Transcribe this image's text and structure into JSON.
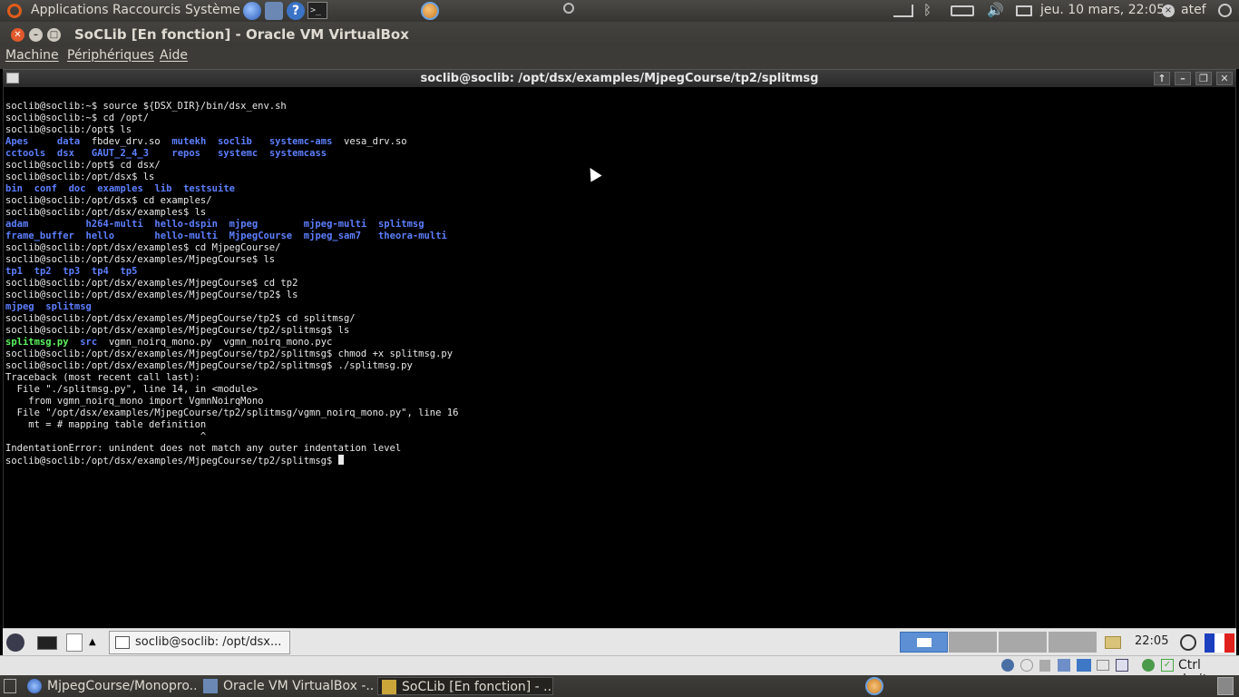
{
  "host_top_panel": {
    "menus": [
      "Applications",
      "Raccourcis",
      "Système"
    ],
    "datetime": "jeu. 10 mars, 22:05",
    "user": "atef"
  },
  "vbox_window": {
    "title": "SoCLib [En fonction] - Oracle VM VirtualBox",
    "menu": [
      "Machine",
      "Périphériques",
      "Aide"
    ]
  },
  "guest": {
    "terminal_title": "soclib@soclib: /opt/dsx/examples/MjpegCourse/tp2/splitmsg",
    "terminal_lines": [
      [
        {
          "t": "soclib@soclib:~$ source ${DSX_DIR}/bin/dsx_env.sh"
        }
      ],
      [
        {
          "t": "soclib@soclib:~$ cd /opt/"
        }
      ],
      [
        {
          "t": "soclib@soclib:/opt$ ls"
        }
      ],
      [
        {
          "t": "Apes",
          "c": "dir"
        },
        {
          "t": "     "
        },
        {
          "t": "data",
          "c": "dir"
        },
        {
          "t": "  fbdev_drv.so  "
        },
        {
          "t": "mutekh",
          "c": "dir"
        },
        {
          "t": "  "
        },
        {
          "t": "soclib",
          "c": "dir"
        },
        {
          "t": "   "
        },
        {
          "t": "systemc-ams",
          "c": "dir"
        },
        {
          "t": "  vesa_drv.so"
        }
      ],
      [
        {
          "t": "cctools",
          "c": "dir"
        },
        {
          "t": "  "
        },
        {
          "t": "dsx",
          "c": "dir"
        },
        {
          "t": "   "
        },
        {
          "t": "GAUT_2_4_3",
          "c": "dir"
        },
        {
          "t": "    "
        },
        {
          "t": "repos",
          "c": "dir"
        },
        {
          "t": "   "
        },
        {
          "t": "systemc",
          "c": "dir"
        },
        {
          "t": "  "
        },
        {
          "t": "systemcass",
          "c": "dir"
        }
      ],
      [
        {
          "t": "soclib@soclib:/opt$ cd dsx/"
        }
      ],
      [
        {
          "t": "soclib@soclib:/opt/dsx$ ls"
        }
      ],
      [
        {
          "t": "bin",
          "c": "dir"
        },
        {
          "t": "  "
        },
        {
          "t": "conf",
          "c": "dir"
        },
        {
          "t": "  "
        },
        {
          "t": "doc",
          "c": "dir"
        },
        {
          "t": "  "
        },
        {
          "t": "examples",
          "c": "dir"
        },
        {
          "t": "  "
        },
        {
          "t": "lib",
          "c": "dir"
        },
        {
          "t": "  "
        },
        {
          "t": "testsuite",
          "c": "dir"
        }
      ],
      [
        {
          "t": "soclib@soclib:/opt/dsx$ cd examples/"
        }
      ],
      [
        {
          "t": "soclib@soclib:/opt/dsx/examples$ ls"
        }
      ],
      [
        {
          "t": "adam",
          "c": "dir"
        },
        {
          "t": "          "
        },
        {
          "t": "h264-multi",
          "c": "dir"
        },
        {
          "t": "  "
        },
        {
          "t": "hello-dspin",
          "c": "dir"
        },
        {
          "t": "  "
        },
        {
          "t": "mjpeg",
          "c": "dir"
        },
        {
          "t": "        "
        },
        {
          "t": "mjpeg-multi",
          "c": "dir"
        },
        {
          "t": "  "
        },
        {
          "t": "splitmsg",
          "c": "dir"
        }
      ],
      [
        {
          "t": "frame_buffer",
          "c": "dir"
        },
        {
          "t": "  "
        },
        {
          "t": "hello",
          "c": "dir"
        },
        {
          "t": "       "
        },
        {
          "t": "hello-multi",
          "c": "dir"
        },
        {
          "t": "  "
        },
        {
          "t": "MjpegCourse",
          "c": "dir"
        },
        {
          "t": "  "
        },
        {
          "t": "mjpeg_sam7",
          "c": "dir"
        },
        {
          "t": "   "
        },
        {
          "t": "theora-multi",
          "c": "dir"
        }
      ],
      [
        {
          "t": "soclib@soclib:/opt/dsx/examples$ cd MjpegCourse/"
        }
      ],
      [
        {
          "t": "soclib@soclib:/opt/dsx/examples/MjpegCourse$ ls"
        }
      ],
      [
        {
          "t": "tp1",
          "c": "dir"
        },
        {
          "t": "  "
        },
        {
          "t": "tp2",
          "c": "dir"
        },
        {
          "t": "  "
        },
        {
          "t": "tp3",
          "c": "dir"
        },
        {
          "t": "  "
        },
        {
          "t": "tp4",
          "c": "dir"
        },
        {
          "t": "  "
        },
        {
          "t": "tp5",
          "c": "dir"
        }
      ],
      [
        {
          "t": "soclib@soclib:/opt/dsx/examples/MjpegCourse$ cd tp2"
        }
      ],
      [
        {
          "t": "soclib@soclib:/opt/dsx/examples/MjpegCourse/tp2$ ls"
        }
      ],
      [
        {
          "t": "mjpeg",
          "c": "dir"
        },
        {
          "t": "  "
        },
        {
          "t": "splitmsg",
          "c": "dir"
        }
      ],
      [
        {
          "t": "soclib@soclib:/opt/dsx/examples/MjpegCourse/tp2$ cd splitmsg/"
        }
      ],
      [
        {
          "t": "soclib@soclib:/opt/dsx/examples/MjpegCourse/tp2/splitmsg$ ls"
        }
      ],
      [
        {
          "t": "splitmsg.py",
          "c": "exe"
        },
        {
          "t": "  "
        },
        {
          "t": "src",
          "c": "dir"
        },
        {
          "t": "  vgmn_noirq_mono.py  vgmn_noirq_mono.pyc"
        }
      ],
      [
        {
          "t": "soclib@soclib:/opt/dsx/examples/MjpegCourse/tp2/splitmsg$ chmod +x splitmsg.py"
        }
      ],
      [
        {
          "t": "soclib@soclib:/opt/dsx/examples/MjpegCourse/tp2/splitmsg$ ./splitmsg.py"
        }
      ],
      [
        {
          "t": "Traceback (most recent call last):"
        }
      ],
      [
        {
          "t": "  File \"./splitmsg.py\", line 14, in <module>"
        }
      ],
      [
        {
          "t": "    from vgmn_noirq_mono import VgmnNoirqMono"
        }
      ],
      [
        {
          "t": "  File \"/opt/dsx/examples/MjpegCourse/tp2/splitmsg/vgmn_noirq_mono.py\", line 16"
        }
      ],
      [
        {
          "t": "    mt = # mapping table definition"
        }
      ],
      [
        {
          "t": "                                  ^"
        }
      ],
      [
        {
          "t": "IndentationError: unindent does not match any outer indentation level"
        }
      ],
      [
        {
          "t": "soclib@soclib:/opt/dsx/examples/MjpegCourse/tp2/splitmsg$ "
        },
        {
          "cursor": true
        }
      ]
    ],
    "taskbar_window": "soclib@soclib: /opt/dsx...",
    "clock": "22:05"
  },
  "vbox_status": {
    "host_key": "Ctrl droite"
  },
  "host_taskbar": [
    {
      "label": "MjpegCourse/Monopro...",
      "icon": "browser-icon"
    },
    {
      "label": "Oracle VM VirtualBox -...",
      "icon": "virtualbox-icon"
    },
    {
      "label": "SoCLib [En fonction] - ...",
      "icon": "virtualbox-icon",
      "active": true
    }
  ],
  "colors": {
    "dir": "#5d7fff",
    "exe": "#5df55d",
    "terminal_bg": "#000000",
    "terminal_fg": "#e8e8e8"
  }
}
